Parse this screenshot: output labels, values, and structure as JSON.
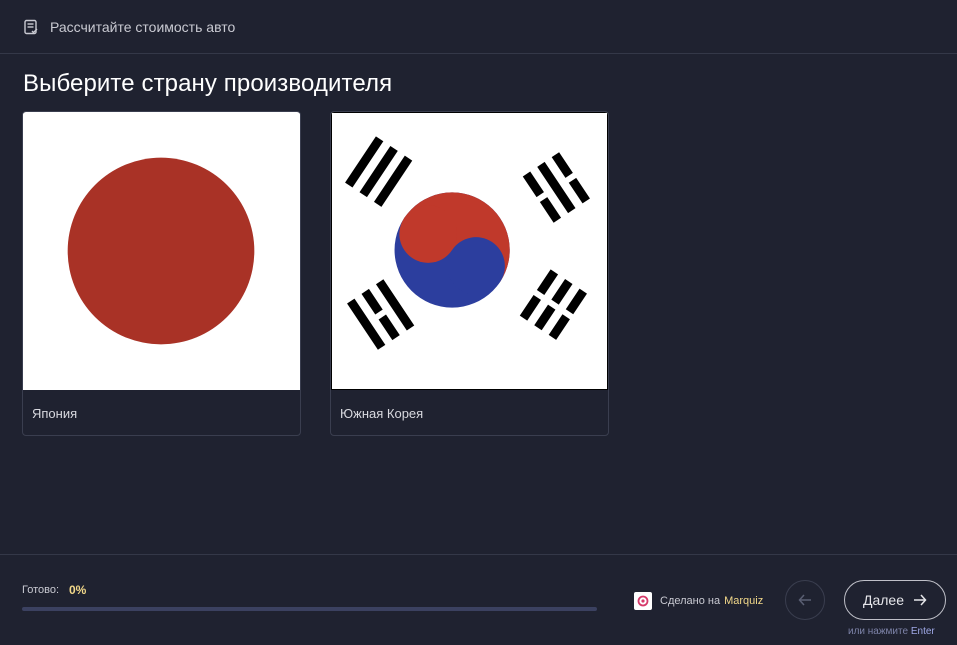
{
  "header": {
    "title": "Рассчитайте стоимость авто",
    "icon": "checklist-icon"
  },
  "question": {
    "title": "Выберите страну производителя"
  },
  "options": [
    {
      "label": "Япония",
      "image": "japan-flag"
    },
    {
      "label": "Южная Корея",
      "image": "south-korea-flag"
    }
  ],
  "progress": {
    "label": "Готово:",
    "value_text": "0%",
    "value": 0
  },
  "footer": {
    "made_by_prefix": "Сделано на",
    "made_by_brand": "Marquiz",
    "next_label": "Далее",
    "hint_prefix": "или нажмите",
    "hint_key": "Enter"
  },
  "colors": {
    "background": "#1f2230",
    "accent": "#f3d98a",
    "progress_track": "#3b4160",
    "japan_red": "#a93226",
    "korea_red": "#c0392b",
    "korea_blue": "#2c3e9e"
  }
}
